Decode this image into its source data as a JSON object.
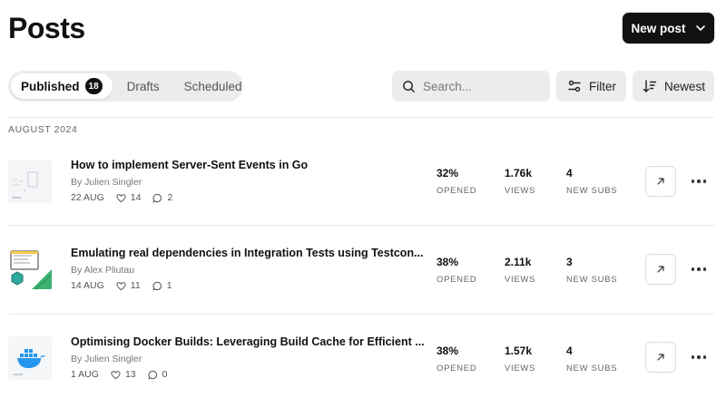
{
  "header": {
    "title": "Posts",
    "new_post_label": "New post"
  },
  "tabs": [
    {
      "label": "Published",
      "count": "18"
    },
    {
      "label": "Drafts"
    },
    {
      "label": "Scheduled"
    }
  ],
  "search": {
    "placeholder": "Search..."
  },
  "filter_label": "Filter",
  "sort_label": "Newest",
  "group_label": "AUGUST 2024",
  "stat_labels": {
    "opened": "OPENED",
    "views": "VIEWS",
    "new_subs": "NEW SUBS"
  },
  "posts": [
    {
      "title": "How to implement Server-Sent Events in Go",
      "author": "By Julien Singler",
      "date": "22 AUG",
      "likes": "14",
      "comments": "2",
      "opened": "32%",
      "views": "1.76k",
      "new_subs": "4"
    },
    {
      "title": "Emulating real dependencies in Integration Tests using Testcon...",
      "author": "By Alex Pliutau",
      "date": "14 AUG",
      "likes": "11",
      "comments": "1",
      "opened": "38%",
      "views": "2.11k",
      "new_subs": "3"
    },
    {
      "title": "Optimising Docker Builds: Leveraging Build Cache for Efficient ...",
      "author": "By Julien Singler",
      "date": "1 AUG",
      "likes": "13",
      "comments": "0",
      "opened": "38%",
      "views": "1.57k",
      "new_subs": "4"
    }
  ]
}
